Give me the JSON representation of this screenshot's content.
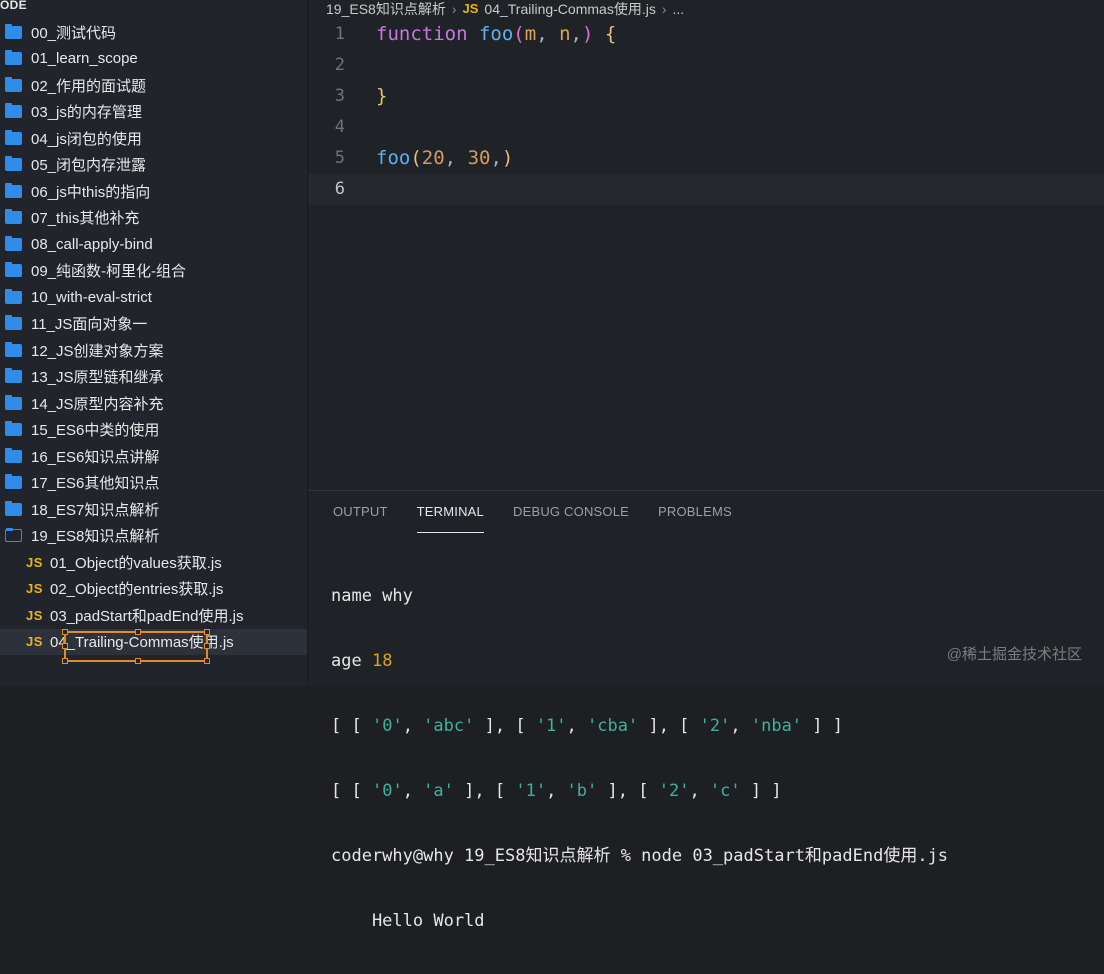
{
  "sidebar": {
    "title": "ODE",
    "items": [
      {
        "type": "folder",
        "label": "00_测试代码"
      },
      {
        "type": "folder",
        "label": "01_learn_scope"
      },
      {
        "type": "folder",
        "label": "02_作用的面试题"
      },
      {
        "type": "folder",
        "label": "03_js的内存管理"
      },
      {
        "type": "folder",
        "label": "04_js闭包的使用"
      },
      {
        "type": "folder",
        "label": "05_闭包内存泄露"
      },
      {
        "type": "folder",
        "label": "06_js中this的指向"
      },
      {
        "type": "folder",
        "label": "07_this其他补充"
      },
      {
        "type": "folder",
        "label": "08_call-apply-bind"
      },
      {
        "type": "folder",
        "label": "09_纯函数-柯里化-组合"
      },
      {
        "type": "folder",
        "label": "10_with-eval-strict"
      },
      {
        "type": "folder",
        "label": "11_JS面向对象一"
      },
      {
        "type": "folder",
        "label": "12_JS创建对象方案"
      },
      {
        "type": "folder",
        "label": "13_JS原型链和继承"
      },
      {
        "type": "folder",
        "label": "14_JS原型内容补充"
      },
      {
        "type": "folder",
        "label": "15_ES6中类的使用"
      },
      {
        "type": "folder",
        "label": "16_ES6知识点讲解"
      },
      {
        "type": "folder",
        "label": "17_ES6其他知识点"
      },
      {
        "type": "folder",
        "label": "18_ES7知识点解析"
      },
      {
        "type": "folder-open",
        "label": "19_ES8知识点解析"
      },
      {
        "type": "file",
        "label": "01_Object的values获取.js"
      },
      {
        "type": "file",
        "label": "02_Object的entries获取.js"
      },
      {
        "type": "file",
        "label": "03_padStart和padEnd使用.js"
      },
      {
        "type": "file",
        "label": "04_Trailing-Commas使用.js",
        "active": true
      }
    ],
    "js_icon": "JS"
  },
  "editor": {
    "breadcrumb": {
      "folder": "19_ES8知识点解析",
      "js_badge": "JS",
      "file": "04_Trailing-Commas使用.js",
      "more": "..."
    },
    "line_numbers": [
      "1",
      "2",
      "3",
      "4",
      "5",
      "6"
    ],
    "code": {
      "l1_kw": "function",
      "l1_fn": "foo",
      "l1_open": "(",
      "l1_p1": "m",
      "l1_comma1": ", ",
      "l1_p2": "n",
      "l1_comma2": ",",
      "l1_close": ")",
      "l1_brace": "{",
      "l3_brace": "}",
      "l5_fn": "foo",
      "l5_open": "(",
      "l5_a1": "20",
      "l5_comma1": ", ",
      "l5_a2": "30",
      "l5_comma2": ",",
      "l5_close": ")"
    }
  },
  "panel": {
    "tabs": [
      "OUTPUT",
      "TERMINAL",
      "DEBUG CONSOLE",
      "PROBLEMS"
    ],
    "active_tab": "TERMINAL",
    "terminal": {
      "l1": "name why",
      "l2_key": "age ",
      "l2_val": "18",
      "l3": {
        "pairs": [
          [
            "'0'",
            "'abc'"
          ],
          [
            "'1'",
            "'cba'"
          ],
          [
            "'2'",
            "'nba'"
          ]
        ]
      },
      "l4": {
        "pairs": [
          [
            "'0'",
            "'a'"
          ],
          [
            "'1'",
            "'b'"
          ],
          [
            "'2'",
            "'c'"
          ]
        ]
      },
      "l5": "coderwhy@why 19_ES8知识点解析 % node 03_padStart和padEnd使用.js",
      "l6": "    Hello World"
    }
  },
  "watermark": "@稀土掘金技术社区",
  "colors": {
    "folder": "#2f8ce8",
    "js_icon": "#e6b422",
    "selection": "#e38b27",
    "keyword": "#c678dd",
    "function": "#61afef"
  }
}
